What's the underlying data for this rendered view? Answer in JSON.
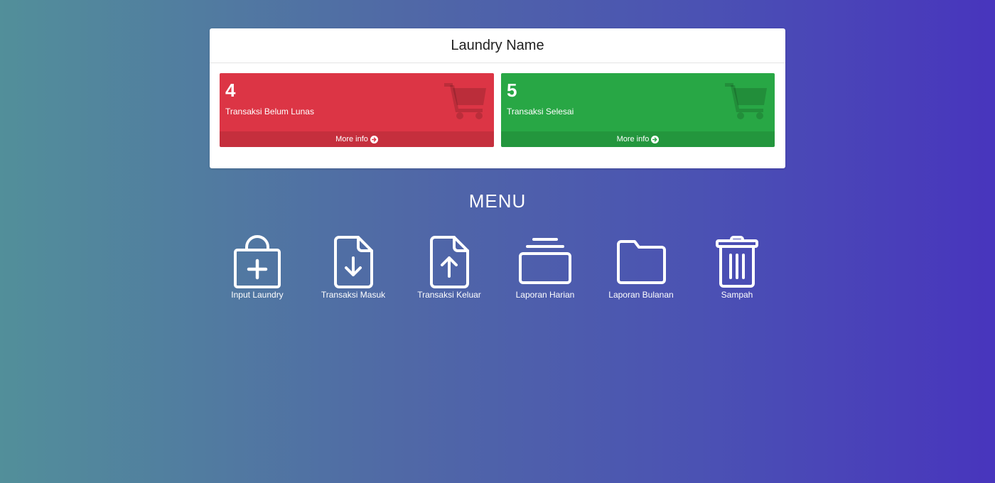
{
  "header": {
    "title": "Laundry Name"
  },
  "boxes": [
    {
      "count": "4",
      "label": "Transaksi Belum Lunas",
      "more": "More info",
      "color": "#dc3545",
      "icon": "shopping-cart-icon"
    },
    {
      "count": "5",
      "label": "Transaksi Selesai",
      "more": "More info",
      "color": "#28a745",
      "icon": "shopping-cart-icon"
    }
  ],
  "menu": {
    "title": "MENU",
    "items": [
      {
        "label": "Input Laundry",
        "icon": "shopping-bag-plus-icon"
      },
      {
        "label": "Transaksi Masuk",
        "icon": "file-download-icon"
      },
      {
        "label": "Transaksi Keluar",
        "icon": "file-upload-icon"
      },
      {
        "label": "Laporan Harian",
        "icon": "layers-icon"
      },
      {
        "label": "Laporan Bulanan",
        "icon": "folder-icon"
      },
      {
        "label": "Sampah",
        "icon": "trash-icon"
      }
    ]
  }
}
